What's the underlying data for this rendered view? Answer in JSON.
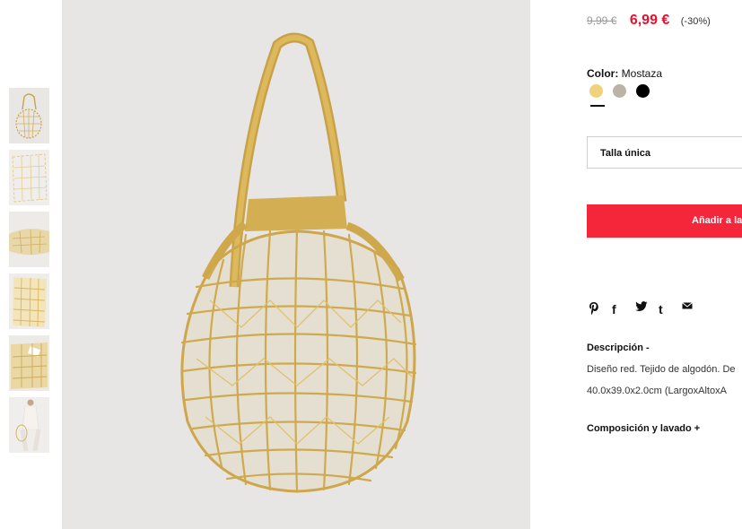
{
  "product": {
    "old_price": "9,99 €",
    "new_price": "6,99 €",
    "discount": "(-30%)",
    "color_label": "Color:",
    "color_value": "Mostaza",
    "swatches": [
      {
        "name": "Mostaza",
        "color": "#f1d27a"
      },
      {
        "name": "Beige",
        "color": "#bcb3a7"
      },
      {
        "name": "Negro",
        "color": "#000000"
      }
    ],
    "size": "Talla única",
    "add_button": "Añadir a la"
  },
  "share": {
    "icons": [
      "pinterest-icon",
      "facebook-icon",
      "twitter-icon",
      "tumblr-icon",
      "email-icon"
    ],
    "f": "f",
    "t": "t"
  },
  "description": {
    "title": "Descripción -",
    "line1": "Diseño red. Tejido de algodón. De",
    "line2": "40.0x39.0x2.0cm (LargoxAltoxA"
  },
  "composition": {
    "title": "Composición y lavado +"
  },
  "colors": {
    "accent_red": "#e8112d",
    "button_red": "#f6263a",
    "bag_mustard": "#d2ae4e",
    "image_bg": "#e7e6e4"
  }
}
